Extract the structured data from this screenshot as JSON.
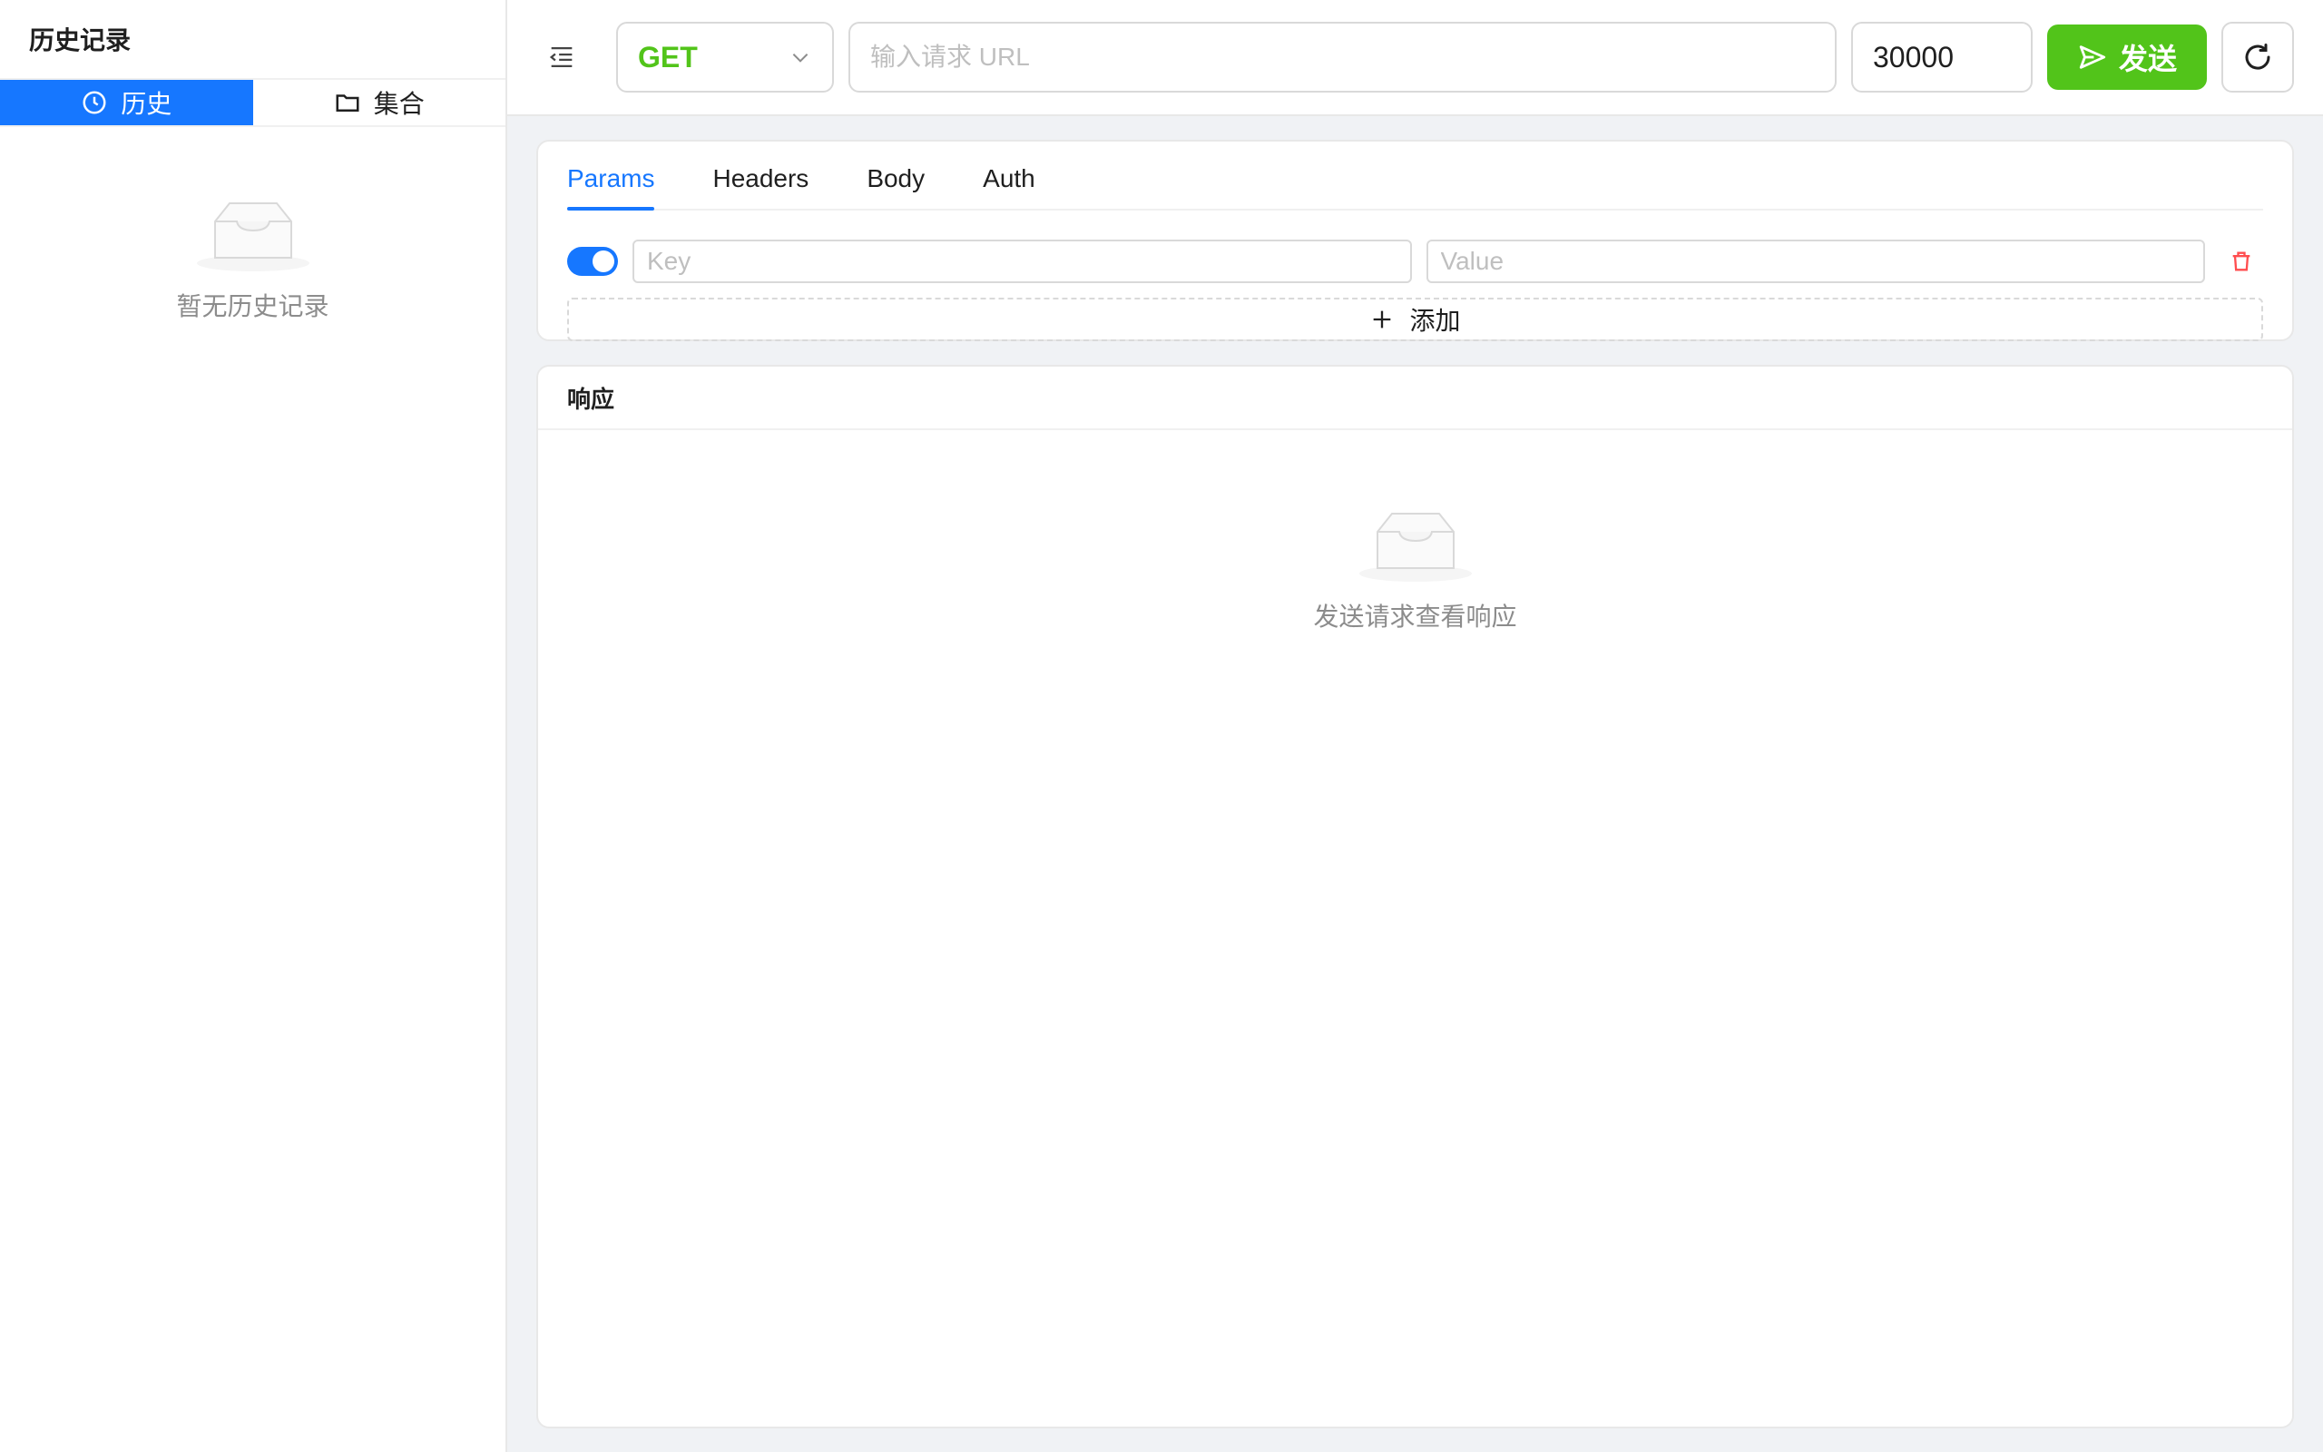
{
  "sidebar": {
    "title": "历史记录",
    "tabs": [
      {
        "label": "历史",
        "icon": "clock-icon",
        "active": true
      },
      {
        "label": "集合",
        "icon": "folder-icon",
        "active": false
      }
    ],
    "empty_text": "暂无历史记录"
  },
  "toolbar": {
    "method": "GET",
    "url_placeholder": "输入请求 URL",
    "url_value": "",
    "timeout_value": "30000",
    "send_label": "发送"
  },
  "request": {
    "tabs": [
      {
        "label": "Params",
        "active": true
      },
      {
        "label": "Headers",
        "active": false
      },
      {
        "label": "Body",
        "active": false
      },
      {
        "label": "Auth",
        "active": false
      }
    ],
    "params": [
      {
        "enabled": true,
        "key_placeholder": "Key",
        "value_placeholder": "Value"
      }
    ],
    "add_label": "添加"
  },
  "response": {
    "title": "响应",
    "empty_text": "发送请求查看响应"
  },
  "colors": {
    "primary": "#1677ff",
    "success": "#52c41a",
    "danger": "#ff4d4f"
  }
}
